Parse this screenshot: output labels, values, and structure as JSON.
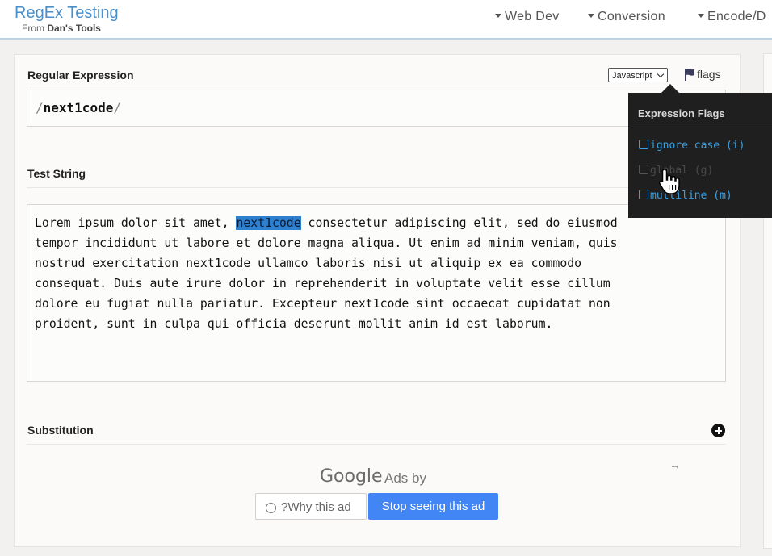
{
  "header": {
    "title": "RegEx Testing",
    "subtitle_prefix": "From",
    "subtitle_brand": "Dan's Tools",
    "nav": [
      "Web Dev",
      "Conversion",
      "Encode/D"
    ]
  },
  "regex": {
    "label": "Regular Expression",
    "delimiter": "/",
    "pattern": "next1code",
    "language": "Javascript",
    "flags_label": "flags"
  },
  "test": {
    "label": "Test String",
    "before_match": "Lorem ipsum dolor sit amet, ",
    "match": "next1code",
    "after_match": " consectetur adipiscing elit, sed do eiusmod\ntempor incididunt ut labore et dolore magna aliqua. Ut enim ad minim veniam, quis\nnostrud exercitation next1code ullamco laboris nisi ut aliquip ex ea commodo\nconsequat. Duis aute irure dolor in reprehenderit in voluptate velit esse cillum\ndolore eu fugiat nulla pariatur. Excepteur next1code sint occaecat cupidatat non\nproident, sunt in culpa qui officia deserunt mollit anim id est laborum."
  },
  "substitution": {
    "label": "Substitution"
  },
  "ad": {
    "google": "Google",
    "ads_by": "Ads by",
    "why_label": "?Why this ad",
    "stop_label": "Stop seeing this ad"
  },
  "flags_popover": {
    "title": "Expression Flags",
    "items": [
      {
        "label": "ignore case (i)",
        "checked": false,
        "state": "active"
      },
      {
        "label": "global (g)",
        "checked": false,
        "state": "dim"
      },
      {
        "label": "multiline (m)",
        "checked": false,
        "state": "active"
      }
    ]
  },
  "colors": {
    "brand": "#4a8fc9",
    "match_highlight": "#2d7fd0",
    "ad_button": "#4285f4",
    "popover_bg": "#1f1f1f",
    "flag_active": "#3aa0e0"
  },
  "icons": {
    "flag": "flag-icon",
    "add": "plus-circle-icon",
    "info": "info-icon",
    "cursor": "hand-pointer-icon",
    "ad_arrow": "arrow-right-icon"
  }
}
